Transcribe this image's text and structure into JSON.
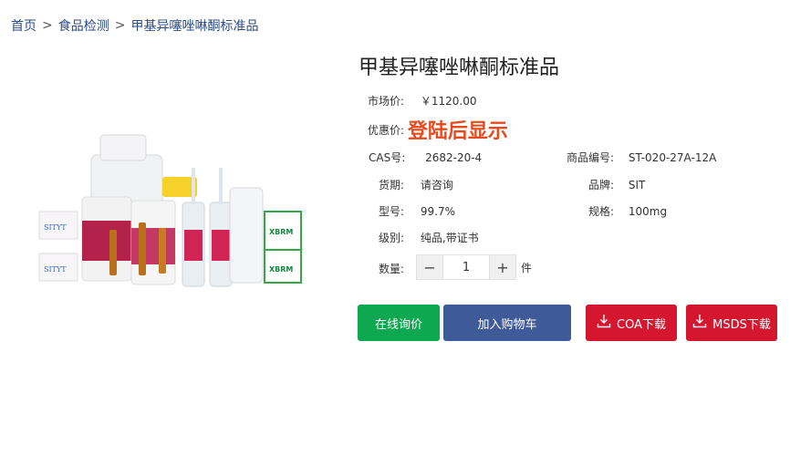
{
  "breadcrumb": {
    "items": [
      "首页",
      "食品检测",
      "甲基异噻唑啉酮标准品"
    ],
    "separator": ">"
  },
  "product": {
    "title": "甲基异噻唑啉酮标准品",
    "market_price_label": "市场价:",
    "market_price_value": "￥1120.00",
    "promo_label": "优惠价:",
    "promo_value": "登陆后显示",
    "cas_label": "CAS号:",
    "cas_value": "2682-20-4",
    "code_label": "商品编号:",
    "code_value": "ST-020-27A-12A",
    "stock_label": "货期:",
    "stock_value": "请咨询",
    "brand_label": "品牌:",
    "brand_value": "SIT",
    "model_label": "型号:",
    "model_value": "99.7%",
    "spec_label": "规格:",
    "spec_value": "100mg",
    "grade_label": "级别:",
    "grade_value": "纯品,带证书",
    "qty_label": "数量:",
    "qty_value": "1",
    "qty_unit": "件",
    "minus": "−",
    "plus": "+"
  },
  "image_labels": {
    "box_brand": "SITYT",
    "kit_brand": "XBRM"
  },
  "buttons": {
    "inquiry": "在线询价",
    "cart": "加入购物车",
    "coa": "COA下载",
    "msds": "MSDS下载"
  },
  "colors": {
    "inquiry": "#0da84f",
    "cart": "#3f5a99",
    "download": "#d4172f",
    "promo": "#e84a1e",
    "breadcrumb": "#2b4a86"
  }
}
